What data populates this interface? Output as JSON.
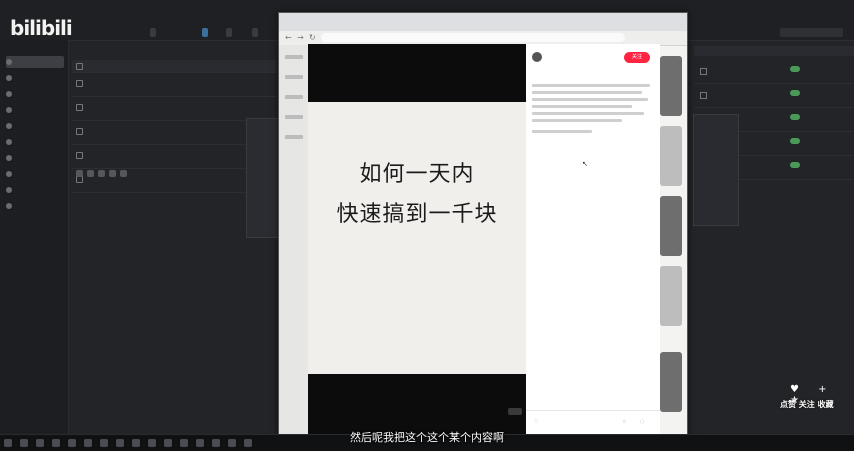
{
  "watermark": "bilibili",
  "topbar": {
    "buttons": [
      "",
      "",
      "",
      ""
    ],
    "search_placeholder": ""
  },
  "sidebar": {
    "items": [
      "",
      "",
      "",
      "",
      "",
      "",
      "",
      "",
      "",
      ""
    ]
  },
  "table": {
    "rows": [
      "",
      "",
      "",
      "",
      ""
    ]
  },
  "context_menu": {
    "items": [
      "",
      "",
      "",
      "",
      ""
    ]
  },
  "browser": {
    "url": "",
    "tabs": [
      "",
      "",
      ""
    ]
  },
  "media": {
    "title_line1": "如何一天内",
    "title_line2": "快速搞到一千块",
    "sub_line1": "",
    "sub_line2": "",
    "sub_line3": ""
  },
  "post": {
    "author": "",
    "follow_label": "关注",
    "title": ""
  },
  "subtitle": "然后呢我把这个这个某个内容啊",
  "social": {
    "labels": "点赞 关注 收藏",
    "glyphs": "♥ + ★"
  }
}
